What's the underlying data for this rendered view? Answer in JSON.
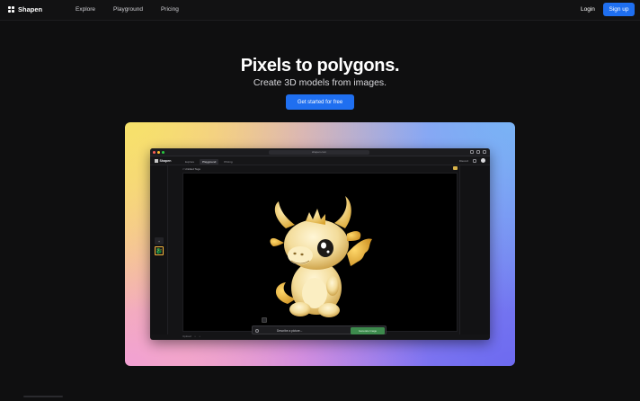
{
  "nav": {
    "brand": "Shapen",
    "links": [
      "Explore",
      "Playground",
      "Pricing"
    ],
    "login": "Login",
    "signup": "Sign up"
  },
  "hero": {
    "title": "Pixels to polygons.",
    "subtitle": "Create 3D models from images.",
    "cta": "Get started for free"
  },
  "mock": {
    "url": "shapen.com",
    "brand": "Shapen",
    "tabs": [
      "Explore",
      "Playground",
      "Pricing"
    ],
    "active_tab": "Playground",
    "right_label": "Discord",
    "subbar": "< Untitled Tags",
    "prompt_placeholder": "Describe a picture...",
    "generate_label": "Generate Image",
    "bottom_items": [
      "Upload",
      "•",
      "•"
    ]
  },
  "colors": {
    "accent": "#1f6ff0",
    "background": "#0f0f10",
    "generate": "#3d8a4d"
  }
}
